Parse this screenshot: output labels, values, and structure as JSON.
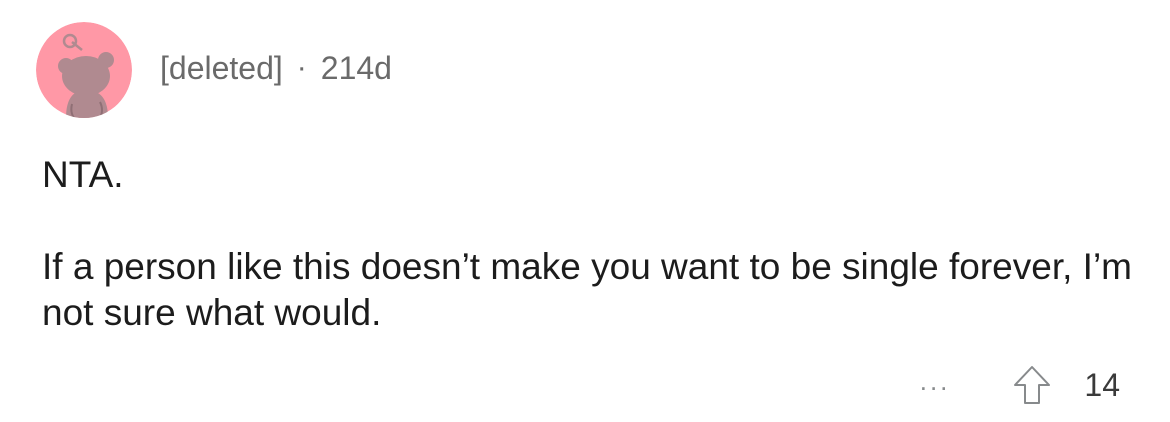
{
  "comment": {
    "username": "[deleted]",
    "separator": "·",
    "age": "214d",
    "avatar_icon": "snoo-avatar-icon",
    "avatar_color": "#ff98a6",
    "paragraphs": [
      "NTA.",
      "If a person like this doesn’t make you want to be single forever, I’m not sure what would."
    ],
    "more_label": "...",
    "upvote_icon": "upvote-arrow-icon",
    "score": "14"
  }
}
